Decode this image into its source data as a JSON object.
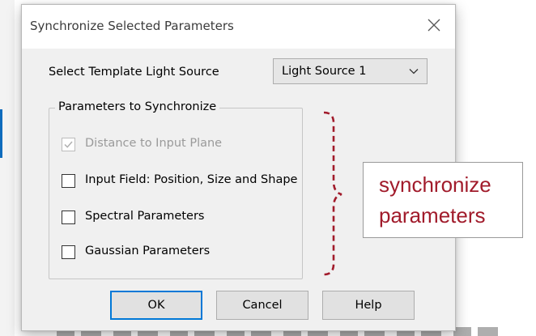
{
  "dialog": {
    "title": "Synchronize Selected Parameters",
    "close_icon": "close-icon"
  },
  "template": {
    "label": "Select Template Light Source",
    "selected": "Light Source 1",
    "dropdown_icon": "chevron-down-icon"
  },
  "group": {
    "title": "Parameters to Synchronize",
    "items": [
      {
        "label": "Distance to Input Plane",
        "checked": true,
        "disabled": true
      },
      {
        "label": "Input Field: Position, Size and Shape",
        "checked": false,
        "disabled": false
      },
      {
        "label": "Spectral Parameters",
        "checked": false,
        "disabled": false
      },
      {
        "label": "Gaussian Parameters",
        "checked": false,
        "disabled": false
      }
    ]
  },
  "buttons": {
    "ok": "OK",
    "cancel": "Cancel",
    "help": "Help"
  },
  "annotation": {
    "line1": "synchronize",
    "line2": "parameters",
    "color": "#a11b2b"
  }
}
